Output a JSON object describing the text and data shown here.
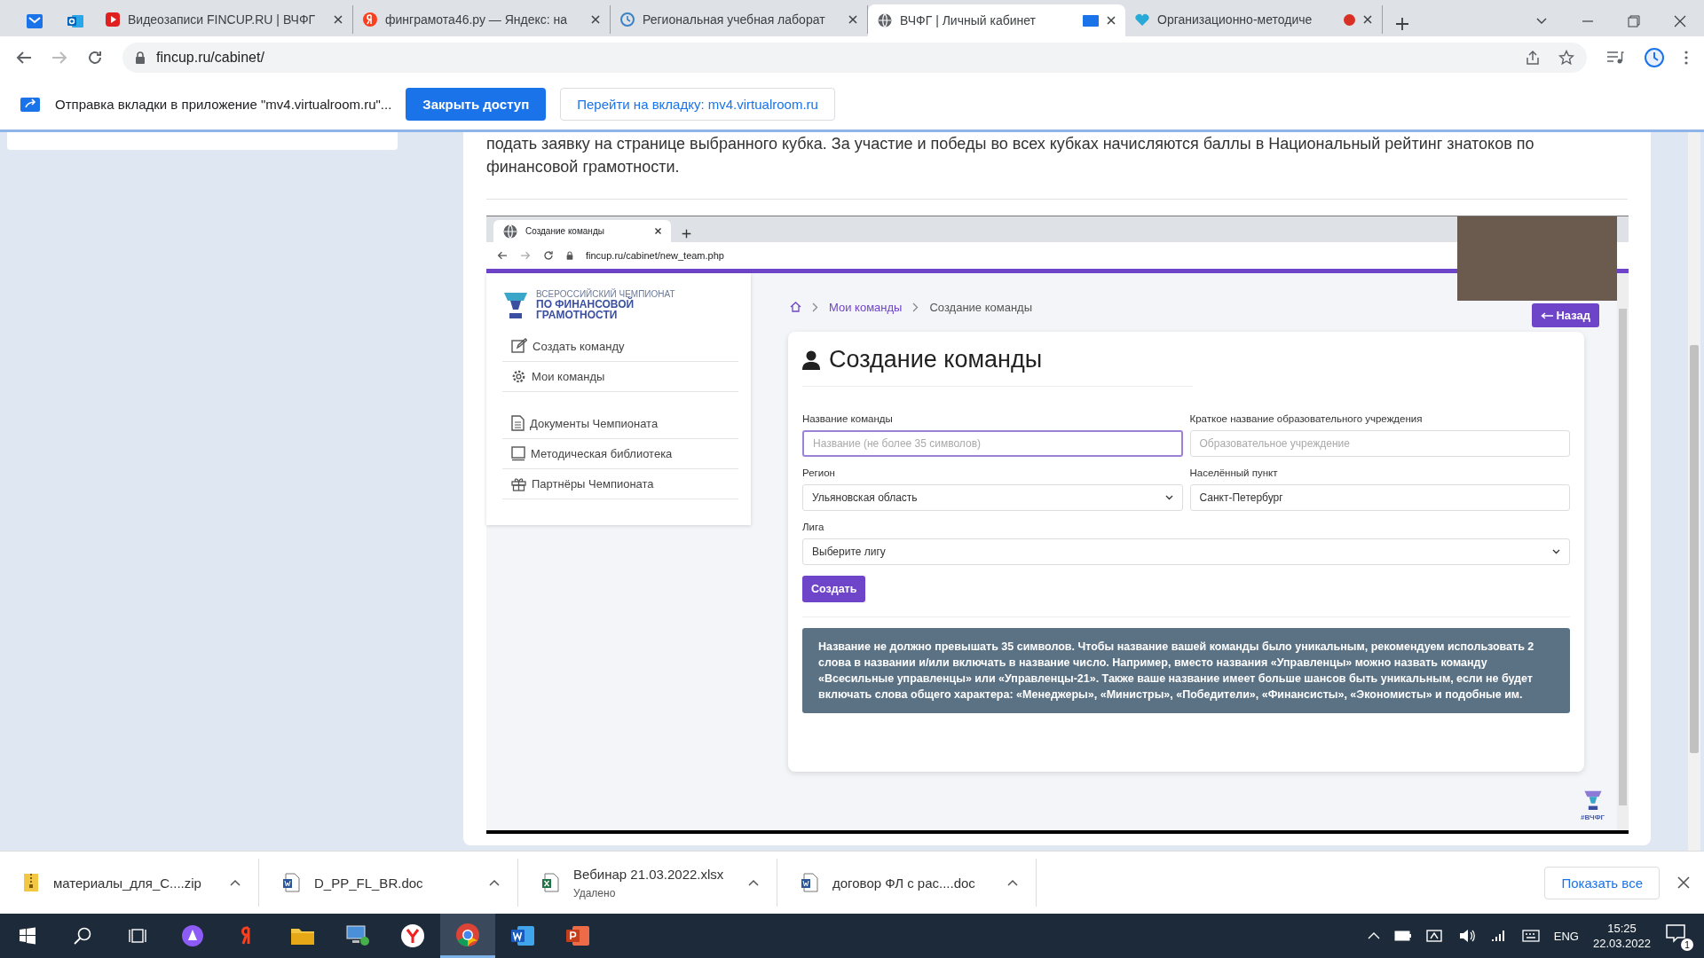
{
  "browser_tabs": [
    {
      "kind": "mail",
      "selected": false
    },
    {
      "kind": "outlook",
      "selected": false
    },
    {
      "kind": "video",
      "title": "Видеозаписи FINCUP.RU | ВЧФГ",
      "selected": false
    },
    {
      "kind": "yandex",
      "title": "финграмота46.ру — Яндекс: на",
      "selected": false
    },
    {
      "kind": "lab",
      "title": "Региональная учебная лаборат",
      "selected": false
    },
    {
      "kind": "globe",
      "title": "ВЧФГ | Личный кабинет",
      "selected": true,
      "sharing": true
    },
    {
      "kind": "heart",
      "title": "Организационно-методиче",
      "selected": false,
      "recording": true
    }
  ],
  "address": "fincup.ru/cabinet/",
  "infobar": {
    "message": "Отправка вкладки в приложение \"mv4.virtualroom.ru\"...",
    "primary_button": "Закрыть доступ",
    "secondary_button": "Перейти на вкладку: mv4.virtualroom.ru"
  },
  "page": {
    "paragraph": "подать заявку на странице выбранного кубка. За участие и победы во всех кубках начисляются баллы в Национальный рейтинг знатоков по финансовой грамотности."
  },
  "embedded_screen": {
    "tab_title": "Создание команды",
    "address": "fincup.ru/cabinet/new_team.php",
    "logo_lines": [
      "ВСЕРОССИЙСКИЙ ЧЕМПИОНАТ",
      "ПО ФИНАНСОВОЙ",
      "ГРАМОТНОСТИ"
    ],
    "menu": [
      {
        "kind": "edit",
        "label": "Создать команду"
      },
      {
        "kind": "gear",
        "label": "Мои команды"
      },
      {
        "kind": "document",
        "label": "Документы Чемпионата"
      },
      {
        "kind": "book",
        "label": "Методическая библиотека"
      },
      {
        "kind": "gift",
        "label": "Партнёры Чемпионата"
      }
    ],
    "breadcrumb": [
      "Мои команды",
      "Создание команды"
    ],
    "back_button": "Назад",
    "heading": "Создание команды",
    "fields": [
      {
        "kind": "input",
        "label": "Название команды",
        "placeholder": "Название (не более 35 символов)",
        "focused": true
      },
      {
        "kind": "input",
        "label": "Краткое название образовательного учреждения",
        "placeholder": "Образовательное учреждение",
        "focused": false
      },
      {
        "kind": "select",
        "label": "Регион",
        "value": "Ульяновская область",
        "focused": false
      },
      {
        "kind": "input",
        "label": "Населённый пункт",
        "value": "Санкт-Петербург",
        "focused": false
      },
      {
        "kind": "select",
        "label": "Лига",
        "value": "Выберите лигу",
        "focused": false,
        "wide": true
      }
    ],
    "submit_button": "Создать",
    "notice": "Название не должно превышать 35 символов. Чтобы название вашей команды было уникальным, рекомендуем использовать 2 слова в названии и/или включать в название число. Например, вместо названия «Управленцы» можно назвать команду «Всесильные управленцы» или «Управленцы-21». Также ваше название имеет больше шансов быть уникальным, если не будет включать слова общего характера: «Менеджеры», «Министры», «Победители», «Финансисты», «Экономисты» и подобные им.",
    "corner_logo": "#ВЧФГ"
  },
  "downloads": [
    {
      "kind": "zip",
      "name": "материалы_для_С....zip"
    },
    {
      "kind": "word",
      "name": "D_PP_FL_BR.doc"
    },
    {
      "kind": "excel",
      "name": "Вебинар 21.03.2022.xlsx",
      "status": "Удалено"
    },
    {
      "kind": "word",
      "name": "договор ФЛ с рас....doc"
    }
  ],
  "show_all_button": "Показать все",
  "taskbar": {
    "apps": [
      {
        "kind": "start",
        "selected": false
      },
      {
        "kind": "search",
        "selected": false
      },
      {
        "kind": "taskview",
        "selected": false
      },
      {
        "kind": "alice",
        "selected": false
      },
      {
        "kind": "yandex",
        "selected": false
      },
      {
        "kind": "explorer",
        "selected": false
      },
      {
        "kind": "network",
        "selected": false
      },
      {
        "kind": "ybrowser",
        "selected": false
      },
      {
        "kind": "chrome",
        "selected": true
      },
      {
        "kind": "word",
        "selected": false
      },
      {
        "kind": "powerpoint",
        "selected": false
      }
    ],
    "language": "ENG",
    "time": "15:25",
    "date": "22.03.2022",
    "notifications": "1"
  }
}
